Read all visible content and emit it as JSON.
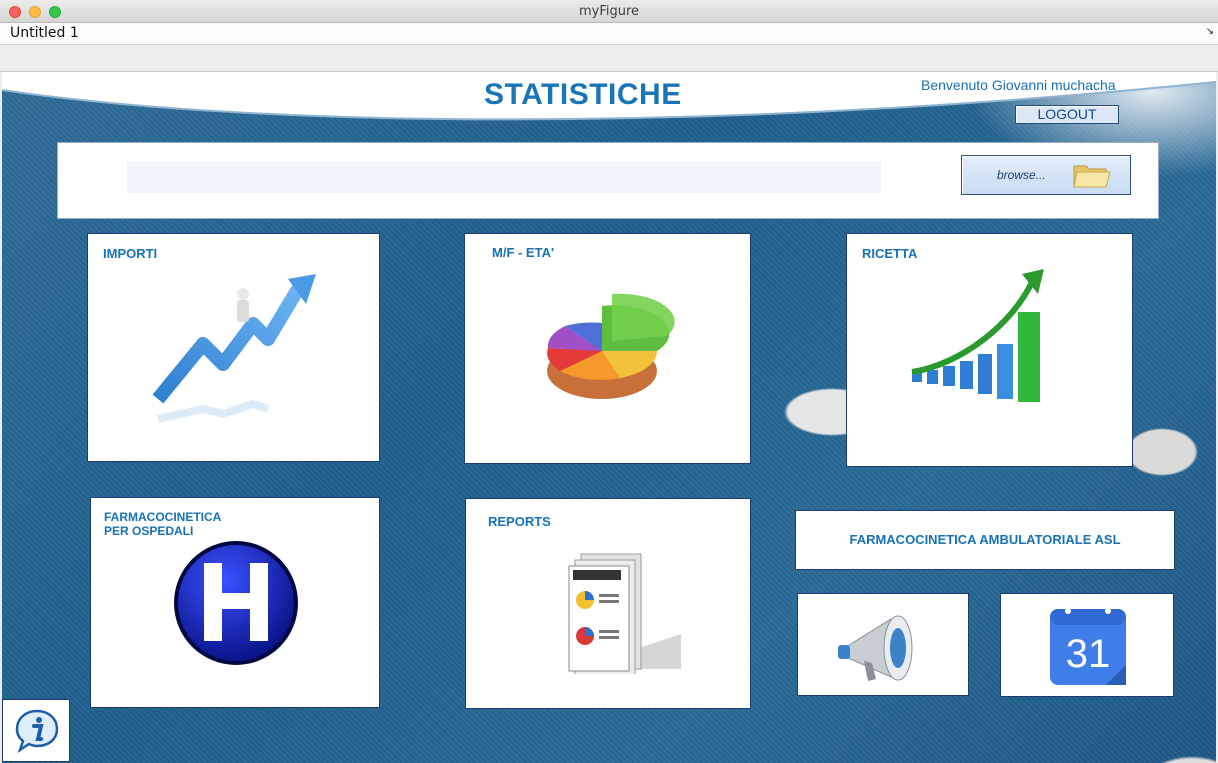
{
  "window": {
    "title": "myFigure",
    "menu_title": "Untitled 1",
    "menu_arrow": "↘"
  },
  "header": {
    "title": "STATISTICHE",
    "welcome": "Benvenuto Giovanni muchacha",
    "logout_label": "LOGOUT"
  },
  "browse": {
    "path_value": "",
    "button_label": "browse..."
  },
  "tiles": {
    "importi": {
      "label": "IMPORTI"
    },
    "mf_eta": {
      "label": "M/F - ETA'"
    },
    "ricetta": {
      "label": "RICETTA"
    },
    "ospedali": {
      "label_line1": "FARMACOCINETICA",
      "label_line2": "PER OSPEDALI"
    },
    "reports": {
      "label": "REPORTS"
    },
    "ambulatoriale": {
      "label": "FARMACOCINETICA AMBULATORIALE ASL"
    },
    "calendar": {
      "day": "31"
    }
  },
  "icons": [
    "trend-arrow-icon",
    "pie-chart-icon",
    "bar-growth-icon",
    "hospital-icon",
    "reports-icon",
    "megaphone-icon",
    "calendar-icon",
    "folder-icon",
    "info-icon"
  ],
  "colors": {
    "accent": "#1772b5",
    "background": "#2a6b98",
    "tile_border": "#1c3d6a"
  }
}
